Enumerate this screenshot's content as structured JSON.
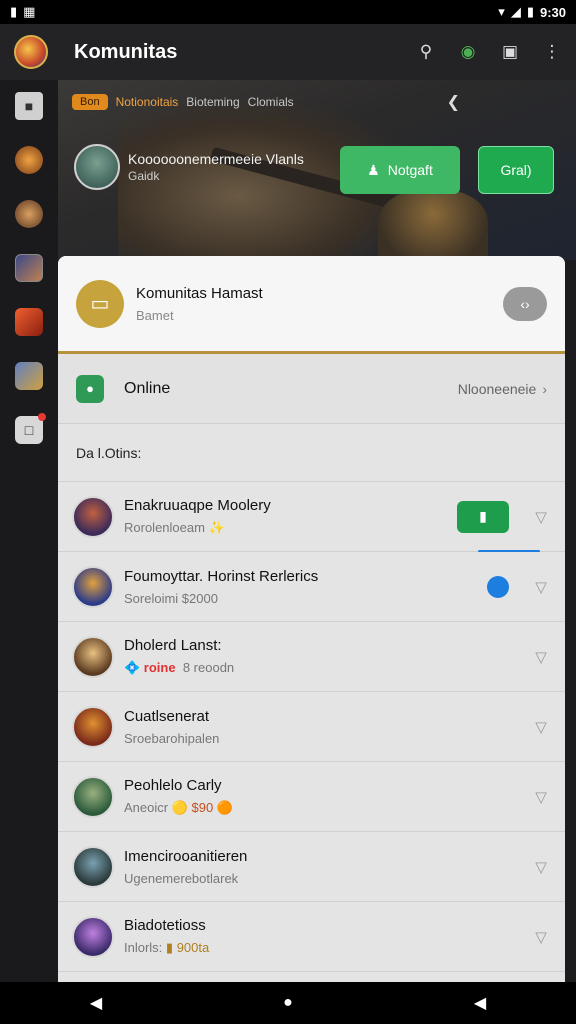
{
  "status_bar": {
    "left_icons": [
      "notification-icon",
      "gallery-icon"
    ],
    "time": "9:30",
    "right_icons": [
      "wifi-icon",
      "signal-icon",
      "battery-icon"
    ]
  },
  "app_bar": {
    "title": "Komunitas",
    "actions": [
      "search-icon",
      "globe-icon",
      "chat-icon",
      "more-vert-icon"
    ]
  },
  "left_rail": {
    "items": [
      {
        "icon": "home-icon"
      },
      {
        "icon": "guild-avatar-1-icon"
      },
      {
        "icon": "guild-avatar-2-icon"
      },
      {
        "icon": "guild-avatar-3-icon"
      },
      {
        "icon": "guild-avatar-4-icon"
      },
      {
        "icon": "guild-avatar-5-icon"
      },
      {
        "icon": "inbox-icon"
      }
    ]
  },
  "hero": {
    "badge": "Bon",
    "tabs": [
      "Notionoitais",
      "Bioteming",
      "Clomials"
    ],
    "active_tab_index": 0,
    "profile_name": "Koooooonemermeeie Vlanls",
    "profile_sub": "Gaidk",
    "join_label": "Notgaft",
    "side_label": "Gral)",
    "accent_color": "#3fb866"
  },
  "sheet": {
    "title": "Komunitas Hamast",
    "subtitle": "Bamet",
    "online_label": "Online",
    "online_action": "Nlooneeneie",
    "section_label": "Da l.Otins:",
    "divider_color": "#b7923e",
    "items": [
      {
        "title": "Enakruuaqpe Moolery",
        "sub": "Rorolenloeam",
        "sub_suffix": "✨",
        "right": "toggle"
      },
      {
        "title": "Foumoyttar. Horinst Rerlerics",
        "sub": "Soreloimi $2000",
        "right": "dot"
      },
      {
        "title": "Dholerd Lanst:",
        "sub_hot": "💠 roine",
        "sub": "8 reoodn",
        "right": "chevron"
      },
      {
        "title": "Cuatlsenerat",
        "sub": "Sroebarohipalen",
        "right": "chevron"
      },
      {
        "title": "Peohlelo Carly",
        "sub": "Aneoicr",
        "sub_suffix": "🟡 $90 🟠",
        "right": "chevron"
      },
      {
        "title": "Imencirooanitieren",
        "sub": "Ugenemerebotlarek",
        "right": "chevron"
      },
      {
        "title": "Biadotetioss",
        "sub": "Inlorls:",
        "sub_suffix": "▮ 900ta",
        "right": "chevron"
      }
    ],
    "avatar_colors": [
      "#5a3a6a",
      "#3a4a8a",
      "#d8a060",
      "#8a4a20",
      "#3a7a4a",
      "#3a5a6a",
      "#6a3a8a"
    ]
  },
  "nav_bar": [
    "back-icon",
    "home-icon",
    "recents-icon"
  ]
}
